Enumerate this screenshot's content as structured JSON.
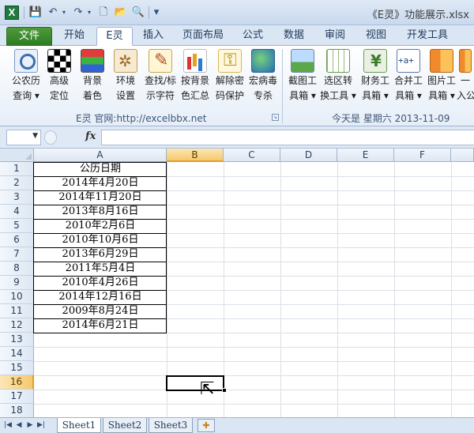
{
  "window": {
    "title": "《E灵》功能展示.xlsx",
    "app_icon": "X"
  },
  "qat": {
    "items": [
      "save-icon",
      "undo-icon",
      "redo-icon",
      "new-icon",
      "open-icon",
      "print-preview-icon",
      "customize-icon"
    ],
    "glyphs": {
      "save": "💾",
      "undo": "↶",
      "redo": "↷",
      "new": "🗋",
      "open": "📂",
      "preview": "🔍",
      "customize": "▾"
    }
  },
  "tabs": [
    {
      "label": "文件",
      "key": "file"
    },
    {
      "label": "开始",
      "key": "home"
    },
    {
      "label": "E灵",
      "key": "eling"
    },
    {
      "label": "插入",
      "key": "insert"
    },
    {
      "label": "页面布局",
      "key": "layout"
    },
    {
      "label": "公式",
      "key": "formulas"
    },
    {
      "label": "数据",
      "key": "data"
    },
    {
      "label": "审阅",
      "key": "review"
    },
    {
      "label": "视图",
      "key": "view"
    },
    {
      "label": "开发工具",
      "key": "developer"
    }
  ],
  "ribbon": {
    "buttons": [
      {
        "line1": "公农历",
        "line2": "查询 ▾",
        "icon": "calendar-search-icon"
      },
      {
        "line1": "高级",
        "line2": "定位",
        "icon": "locate-grid-icon"
      },
      {
        "line1": "背景",
        "line2": "着色",
        "icon": "color-bars-icon"
      },
      {
        "line1": "环境",
        "line2": "设置",
        "icon": "settings-tools-icon"
      },
      {
        "line1": "查找/标",
        "line2": "示字符",
        "icon": "find-mark-icon"
      },
      {
        "line1": "按背景",
        "line2": "色汇总",
        "icon": "sum-by-color-icon"
      },
      {
        "line1": "解除密",
        "line2": "码保护",
        "icon": "unlock-key-icon"
      },
      {
        "line1": "宏病毒",
        "line2": "专杀",
        "icon": "virus-kill-icon"
      },
      {
        "line1": "截图工",
        "line2": "具箱 ▾",
        "icon": "screenshot-icon"
      },
      {
        "line1": "选区转",
        "line2": "换工具 ▾",
        "icon": "range-convert-icon"
      },
      {
        "line1": "财务工",
        "line2": "具箱 ▾",
        "icon": "finance-icon"
      },
      {
        "line1": "合并工",
        "line2": "具箱 ▾",
        "icon": "merge-icon"
      },
      {
        "line1": "图片工",
        "line2": "具箱 ▾",
        "icon": "picture-tools-icon"
      },
      {
        "line1": "一",
        "line2": "入公",
        "icon": "books-icon"
      }
    ],
    "group1_label": "E灵 官网:http://excelbbx.net",
    "group2_label": "今天是  星期六 2013-11-09"
  },
  "formula_bar": {
    "name_box": "",
    "fx": "fx",
    "content": ""
  },
  "grid": {
    "columns": [
      "A",
      "B",
      "C",
      "D",
      "E",
      "F"
    ],
    "selected_column": "B",
    "rows": [
      "1",
      "2",
      "3",
      "4",
      "5",
      "6",
      "7",
      "8",
      "9",
      "10",
      "11",
      "12",
      "13",
      "14",
      "15",
      "16",
      "17",
      "18"
    ],
    "selected_row": "16",
    "colA": [
      "公历日期",
      "2014年4月20日",
      "2014年11月20日",
      "2013年8月16日",
      "2010年2月6日",
      "2010年10月6日",
      "2013年6月29日",
      "2011年5月4日",
      "2010年4月26日",
      "2014年12月16日",
      "2009年8月24日",
      "2014年6月21日"
    ]
  },
  "sheets": {
    "tabs": [
      "Sheet1",
      "Sheet2",
      "Sheet3"
    ],
    "active": "Sheet1",
    "nav": [
      "|◀",
      "◀",
      "▶",
      "▶|"
    ]
  }
}
